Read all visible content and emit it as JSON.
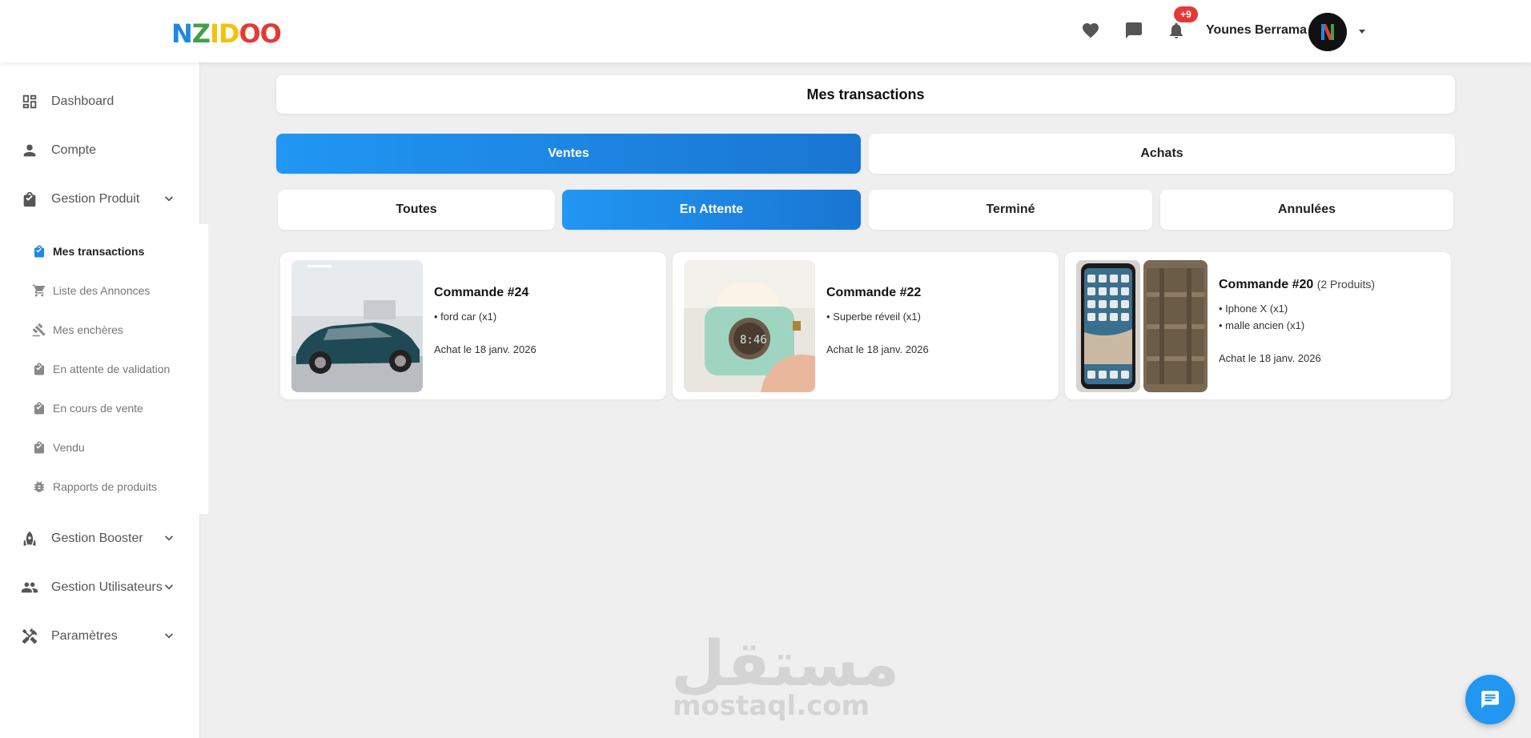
{
  "header": {
    "logo": "NZIDOO",
    "notif_badge": "+9",
    "user_name": "Younes Berrama",
    "icons": [
      "heart-icon",
      "message-icon",
      "bell-icon",
      "caret-down-icon"
    ]
  },
  "sidebar": {
    "items": [
      {
        "label": "Dashboard",
        "icon": "dashboard-icon"
      },
      {
        "label": "Compte",
        "icon": "person-icon"
      },
      {
        "label": "Gestion Produit",
        "icon": "shopping-bag-icon"
      },
      {
        "label": "Gestion Booster",
        "icon": "rocket-icon"
      },
      {
        "label": "Gestion Utilisateurs",
        "icon": "users-icon"
      },
      {
        "label": "Paramètres",
        "icon": "tools-icon"
      }
    ],
    "sub_items": [
      {
        "label": "Mes transactions",
        "icon": "shopping-bag-icon",
        "active": true
      },
      {
        "label": "Liste des Annonces",
        "icon": "cart-icon"
      },
      {
        "label": "Mes enchères",
        "icon": "gavel-icon"
      },
      {
        "label": "En attente de validation",
        "icon": "shopping-bag-icon"
      },
      {
        "label": "En cours de vente",
        "icon": "shopping-bag-icon"
      },
      {
        "label": "Vendu",
        "icon": "shopping-bag-icon"
      },
      {
        "label": "Rapports de produits",
        "icon": "bug-icon"
      }
    ]
  },
  "main": {
    "title": "Mes transactions",
    "type_tabs": [
      {
        "label": "Ventes",
        "active": true
      },
      {
        "label": "Achats",
        "active": false
      }
    ],
    "status_tabs": [
      {
        "label": "Toutes",
        "active": false
      },
      {
        "label": "En Attente",
        "active": true
      },
      {
        "label": "Terminé",
        "active": false
      },
      {
        "label": "Annulées",
        "active": false
      }
    ],
    "orders": [
      {
        "title": "Commande #24",
        "count": "",
        "items": [
          "• ford car (x1)"
        ],
        "date": "Achat le 18 janv. 2026"
      },
      {
        "title": "Commande #22",
        "count": "",
        "items": [
          "• Superbe réveil (x1)"
        ],
        "date": "Achat le 18 janv. 2026"
      },
      {
        "title": "Commande #20",
        "count": "(2 Produits)",
        "items": [
          "• Iphone X (x1)",
          "• malle ancien (x1)"
        ],
        "date": "Achat le 18 janv. 2026"
      }
    ]
  },
  "watermark": {
    "arabic": "مستقل",
    "latin": "mostaql.com"
  },
  "colors": {
    "accent": "#1e88e5",
    "badge": "#e53935",
    "background": "#efefef"
  }
}
